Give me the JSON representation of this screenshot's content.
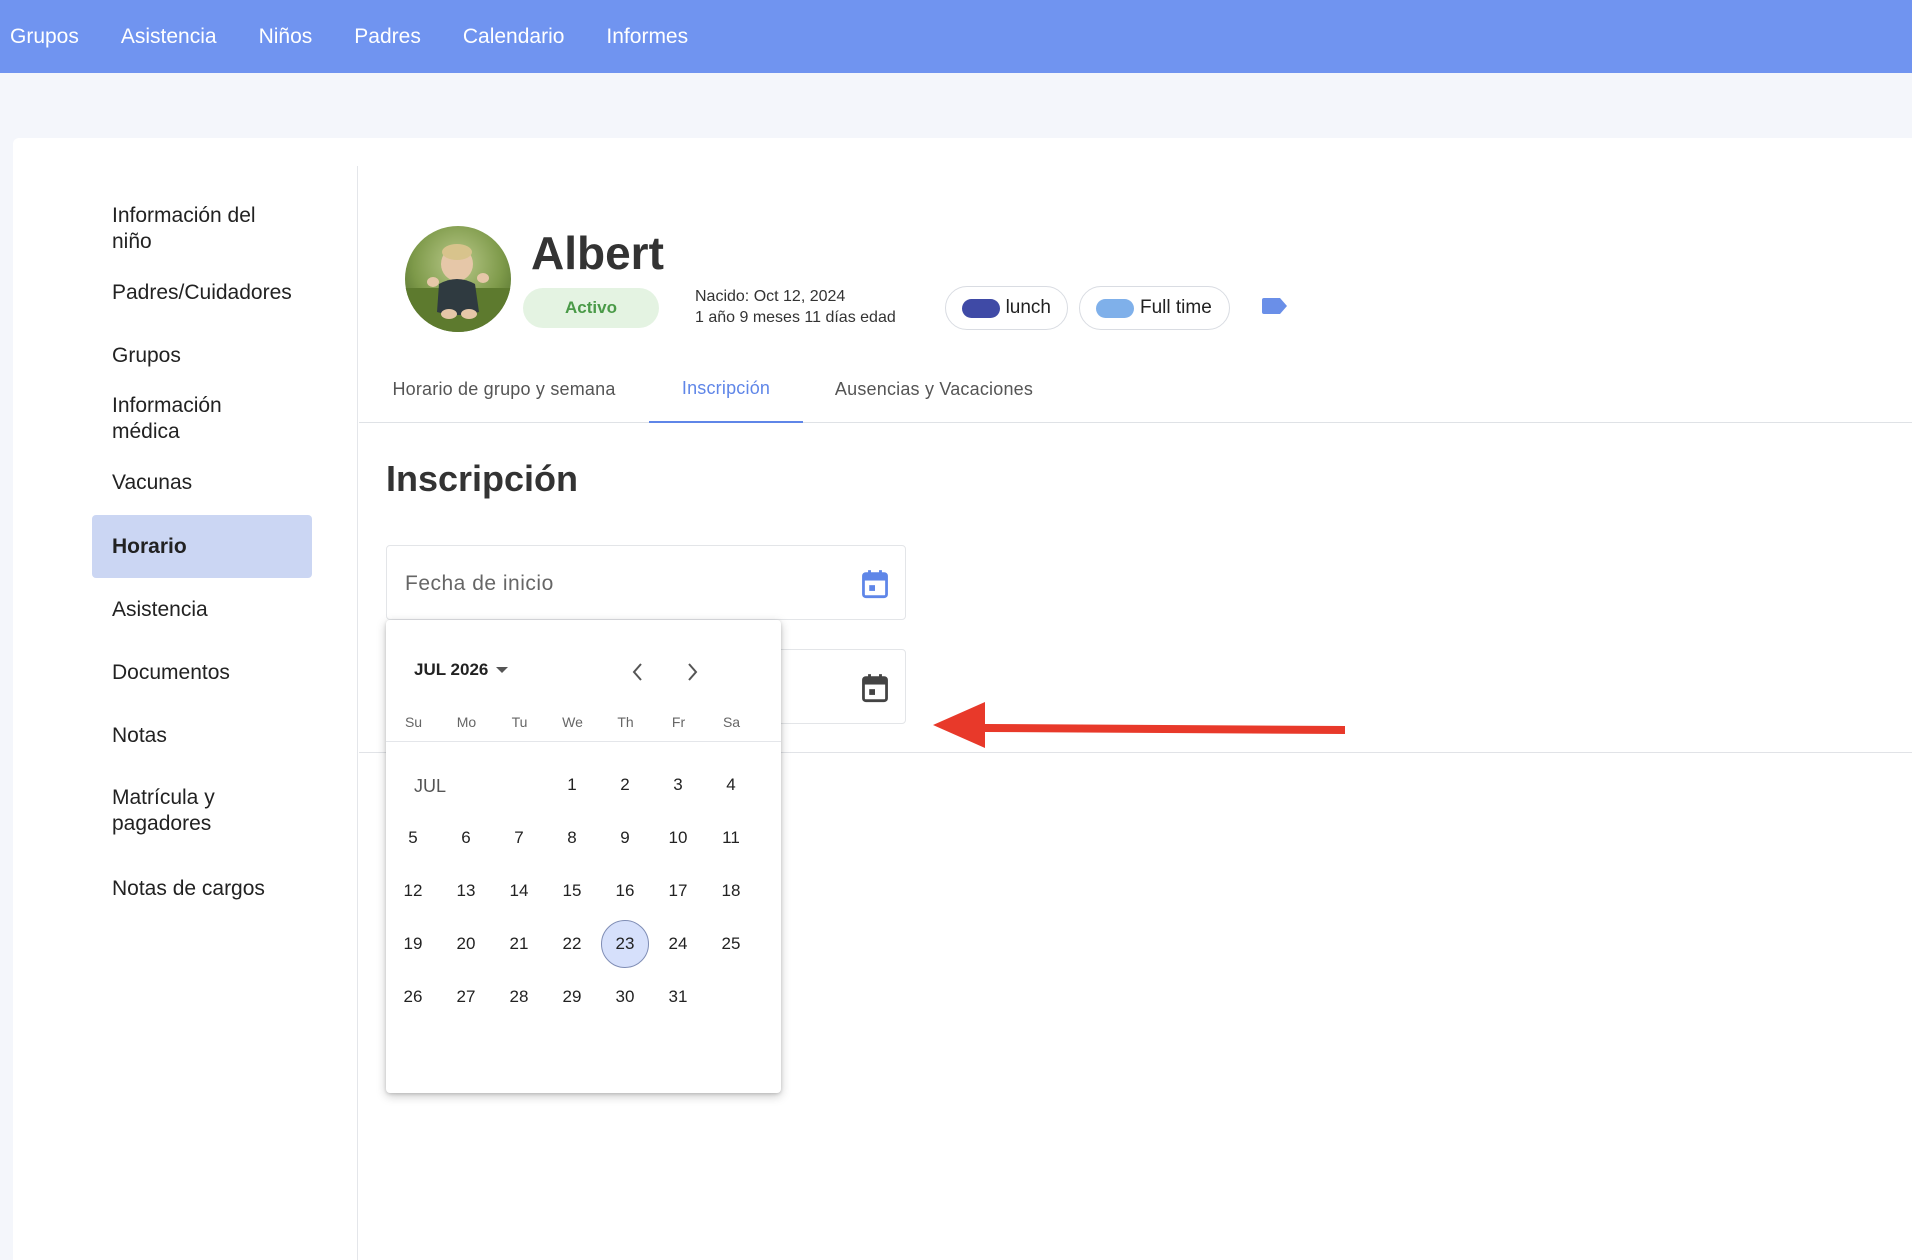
{
  "topnav": {
    "items": [
      "Grupos",
      "Asistencia",
      "Niños",
      "Padres",
      "Calendario",
      "Informes"
    ]
  },
  "sidebar": {
    "items": [
      {
        "label": "Información del niño"
      },
      {
        "label": "Padres/Cuidadores"
      },
      {
        "label": "Grupos"
      },
      {
        "label": "Información médica"
      },
      {
        "label": "Vacunas"
      },
      {
        "label": "Horario",
        "active": true
      },
      {
        "label": "Asistencia"
      },
      {
        "label": "Documentos"
      },
      {
        "label": "Notas"
      },
      {
        "label": "Matrícula y pagadores"
      },
      {
        "label": "Notas de cargos"
      }
    ]
  },
  "profile": {
    "name": "Albert",
    "status": "Activo",
    "born": "Nacido: Oct 12, 2024",
    "age": "1 año 9 meses 11 días edad",
    "tags": [
      {
        "label": "lunch",
        "color": "#3f4aa6"
      },
      {
        "label": "Full time",
        "color": "#7fb0ea"
      }
    ],
    "tag_add_color": "#6a8fe8"
  },
  "tabs": [
    {
      "label": "Horario de grupo y semana"
    },
    {
      "label": "Inscripción",
      "active": true
    },
    {
      "label": "Ausencias y Vacaciones"
    }
  ],
  "section": {
    "title": "Inscripción",
    "start_date_placeholder": "Fecha de inicio",
    "end_date_placeholder": ""
  },
  "datepicker": {
    "month_year": "JUL 2026",
    "month_label": "JUL",
    "weekdays": [
      "Su",
      "Mo",
      "Tu",
      "We",
      "Th",
      "Fr",
      "Sa"
    ],
    "first_weekday_index": 3,
    "days_in_month": 31,
    "selected_day": 23
  },
  "colors": {
    "accent": "#5f86e8",
    "nav_bg": "#7094f0",
    "arrow": "#e8392a"
  }
}
